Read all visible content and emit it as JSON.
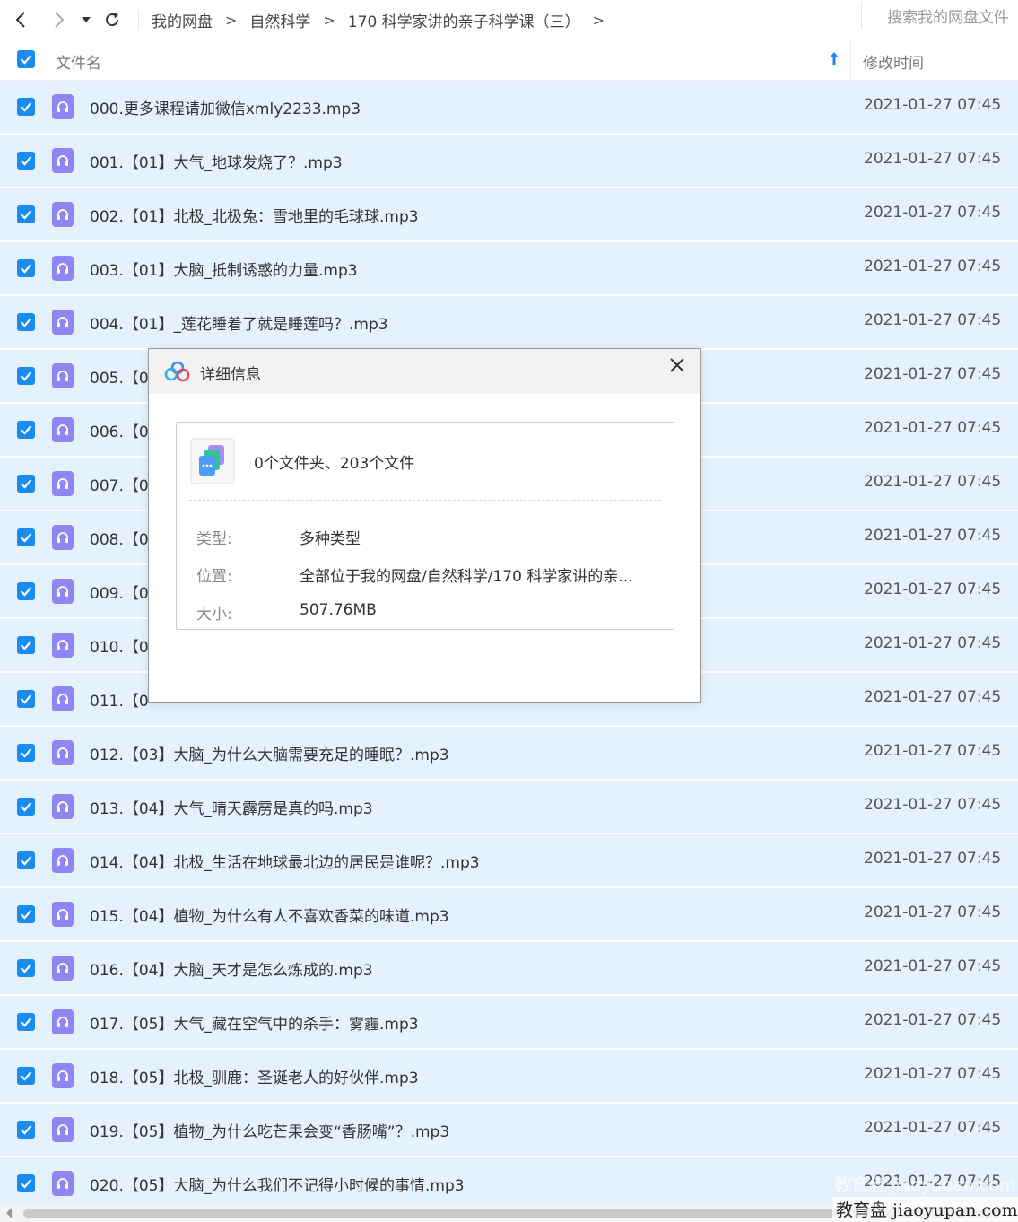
{
  "toolbar": {
    "breadcrumb": [
      "我的网盘",
      "自然科学",
      "170 科学家讲的亲子科学课（三）"
    ],
    "breadcrumb_sep": ">",
    "trailing_arrow": ">",
    "search_placeholder": "搜索我的网盘文件"
  },
  "table": {
    "col_name": "文件名",
    "col_time": "修改时间"
  },
  "files": [
    {
      "name": "000.更多课程请加微信xmly2233.mp3",
      "time": "2021-01-27 07:45"
    },
    {
      "name": "001.【01】大气_地球发烧了？.mp3",
      "time": "2021-01-27 07:45"
    },
    {
      "name": "002.【01】北极_北极兔：雪地里的毛球球.mp3",
      "time": "2021-01-27 07:45"
    },
    {
      "name": "003.【01】大脑_抵制诱惑的力量.mp3",
      "time": "2021-01-27 07:45"
    },
    {
      "name": "004.【01】_莲花睡着了就是睡莲吗？.mp3",
      "time": "2021-01-27 07:45"
    },
    {
      "name": "005.【0",
      "time": "2021-01-27 07:45"
    },
    {
      "name": "006.【0",
      "time": "2021-01-27 07:45"
    },
    {
      "name": "007.【0",
      "time": "2021-01-27 07:45"
    },
    {
      "name": "008.【0",
      "time": "2021-01-27 07:45"
    },
    {
      "name": "009.【0",
      "time": "2021-01-27 07:45"
    },
    {
      "name": "010.【0",
      "time": "2021-01-27 07:45"
    },
    {
      "name": "011.【0",
      "time": "2021-01-27 07:45"
    },
    {
      "name": "012.【03】大脑_为什么大脑需要充足的睡眠？.mp3",
      "time": "2021-01-27 07:45"
    },
    {
      "name": "013.【04】大气_晴天霹雳是真的吗.mp3",
      "time": "2021-01-27 07:45"
    },
    {
      "name": "014.【04】北极_生活在地球最北边的居民是谁呢？.mp3",
      "time": "2021-01-27 07:45"
    },
    {
      "name": "015.【04】植物_为什么有人不喜欢香菜的味道.mp3",
      "time": "2021-01-27 07:45"
    },
    {
      "name": "016.【04】大脑_天才是怎么炼成的.mp3",
      "time": "2021-01-27 07:45"
    },
    {
      "name": "017.【05】大气_藏在空气中的杀手：雾霾.mp3",
      "time": "2021-01-27 07:45"
    },
    {
      "name": "018.【05】北极_驯鹿：圣诞老人的好伙伴.mp3",
      "time": "2021-01-27 07:45"
    },
    {
      "name": "019.【05】植物_为什么吃芒果会变“香肠嘴”？.mp3",
      "time": "2021-01-27 07:45"
    },
    {
      "name": "020.【05】大脑_为什么我们不记得小时候的事情.mp3",
      "time": "2021-01-27 07:45"
    }
  ],
  "dialog": {
    "title": "详细信息",
    "summary": "0个文件夹、203个文件",
    "type_label": "类型:",
    "type_value": "多种类型",
    "location_label": "位置:",
    "location_value": "全部位于我的网盘/自然科学/170 科学家讲的亲...",
    "size_label": "大小:",
    "size_value": "507.76MB"
  },
  "watermark": "教育盘 jiaoyupan.com",
  "colors": {
    "accent": "#1a8cf0",
    "row_selected": "#e5f2fd",
    "file_icon": "#8f86f2"
  }
}
